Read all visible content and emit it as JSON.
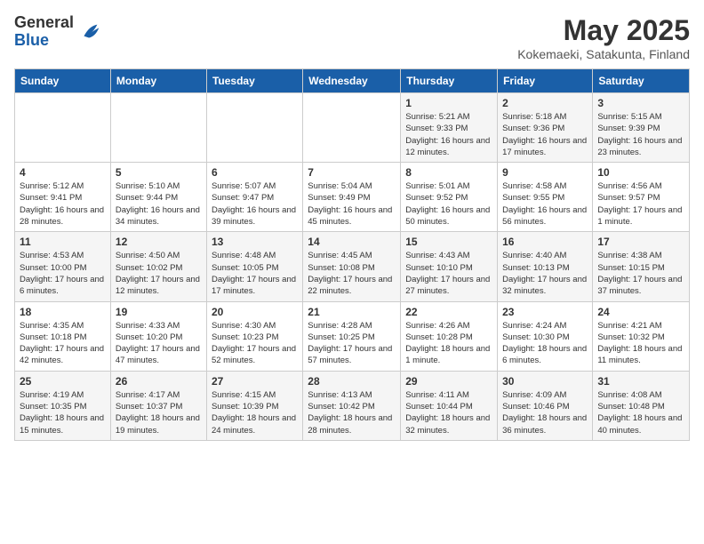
{
  "logo": {
    "text_general": "General",
    "text_blue": "Blue"
  },
  "title": "May 2025",
  "subtitle": "Kokemaeki, Satakunta, Finland",
  "headers": [
    "Sunday",
    "Monday",
    "Tuesday",
    "Wednesday",
    "Thursday",
    "Friday",
    "Saturday"
  ],
  "weeks": [
    [
      {
        "day": "",
        "info": ""
      },
      {
        "day": "",
        "info": ""
      },
      {
        "day": "",
        "info": ""
      },
      {
        "day": "",
        "info": ""
      },
      {
        "day": "1",
        "info": "Sunrise: 5:21 AM\nSunset: 9:33 PM\nDaylight: 16 hours and 12 minutes."
      },
      {
        "day": "2",
        "info": "Sunrise: 5:18 AM\nSunset: 9:36 PM\nDaylight: 16 hours and 17 minutes."
      },
      {
        "day": "3",
        "info": "Sunrise: 5:15 AM\nSunset: 9:39 PM\nDaylight: 16 hours and 23 minutes."
      }
    ],
    [
      {
        "day": "4",
        "info": "Sunrise: 5:12 AM\nSunset: 9:41 PM\nDaylight: 16 hours and 28 minutes."
      },
      {
        "day": "5",
        "info": "Sunrise: 5:10 AM\nSunset: 9:44 PM\nDaylight: 16 hours and 34 minutes."
      },
      {
        "day": "6",
        "info": "Sunrise: 5:07 AM\nSunset: 9:47 PM\nDaylight: 16 hours and 39 minutes."
      },
      {
        "day": "7",
        "info": "Sunrise: 5:04 AM\nSunset: 9:49 PM\nDaylight: 16 hours and 45 minutes."
      },
      {
        "day": "8",
        "info": "Sunrise: 5:01 AM\nSunset: 9:52 PM\nDaylight: 16 hours and 50 minutes."
      },
      {
        "day": "9",
        "info": "Sunrise: 4:58 AM\nSunset: 9:55 PM\nDaylight: 16 hours and 56 minutes."
      },
      {
        "day": "10",
        "info": "Sunrise: 4:56 AM\nSunset: 9:57 PM\nDaylight: 17 hours and 1 minute."
      }
    ],
    [
      {
        "day": "11",
        "info": "Sunrise: 4:53 AM\nSunset: 10:00 PM\nDaylight: 17 hours and 6 minutes."
      },
      {
        "day": "12",
        "info": "Sunrise: 4:50 AM\nSunset: 10:02 PM\nDaylight: 17 hours and 12 minutes."
      },
      {
        "day": "13",
        "info": "Sunrise: 4:48 AM\nSunset: 10:05 PM\nDaylight: 17 hours and 17 minutes."
      },
      {
        "day": "14",
        "info": "Sunrise: 4:45 AM\nSunset: 10:08 PM\nDaylight: 17 hours and 22 minutes."
      },
      {
        "day": "15",
        "info": "Sunrise: 4:43 AM\nSunset: 10:10 PM\nDaylight: 17 hours and 27 minutes."
      },
      {
        "day": "16",
        "info": "Sunrise: 4:40 AM\nSunset: 10:13 PM\nDaylight: 17 hours and 32 minutes."
      },
      {
        "day": "17",
        "info": "Sunrise: 4:38 AM\nSunset: 10:15 PM\nDaylight: 17 hours and 37 minutes."
      }
    ],
    [
      {
        "day": "18",
        "info": "Sunrise: 4:35 AM\nSunset: 10:18 PM\nDaylight: 17 hours and 42 minutes."
      },
      {
        "day": "19",
        "info": "Sunrise: 4:33 AM\nSunset: 10:20 PM\nDaylight: 17 hours and 47 minutes."
      },
      {
        "day": "20",
        "info": "Sunrise: 4:30 AM\nSunset: 10:23 PM\nDaylight: 17 hours and 52 minutes."
      },
      {
        "day": "21",
        "info": "Sunrise: 4:28 AM\nSunset: 10:25 PM\nDaylight: 17 hours and 57 minutes."
      },
      {
        "day": "22",
        "info": "Sunrise: 4:26 AM\nSunset: 10:28 PM\nDaylight: 18 hours and 1 minute."
      },
      {
        "day": "23",
        "info": "Sunrise: 4:24 AM\nSunset: 10:30 PM\nDaylight: 18 hours and 6 minutes."
      },
      {
        "day": "24",
        "info": "Sunrise: 4:21 AM\nSunset: 10:32 PM\nDaylight: 18 hours and 11 minutes."
      }
    ],
    [
      {
        "day": "25",
        "info": "Sunrise: 4:19 AM\nSunset: 10:35 PM\nDaylight: 18 hours and 15 minutes."
      },
      {
        "day": "26",
        "info": "Sunrise: 4:17 AM\nSunset: 10:37 PM\nDaylight: 18 hours and 19 minutes."
      },
      {
        "day": "27",
        "info": "Sunrise: 4:15 AM\nSunset: 10:39 PM\nDaylight: 18 hours and 24 minutes."
      },
      {
        "day": "28",
        "info": "Sunrise: 4:13 AM\nSunset: 10:42 PM\nDaylight: 18 hours and 28 minutes."
      },
      {
        "day": "29",
        "info": "Sunrise: 4:11 AM\nSunset: 10:44 PM\nDaylight: 18 hours and 32 minutes."
      },
      {
        "day": "30",
        "info": "Sunrise: 4:09 AM\nSunset: 10:46 PM\nDaylight: 18 hours and 36 minutes."
      },
      {
        "day": "31",
        "info": "Sunrise: 4:08 AM\nSunset: 10:48 PM\nDaylight: 18 hours and 40 minutes."
      }
    ]
  ]
}
